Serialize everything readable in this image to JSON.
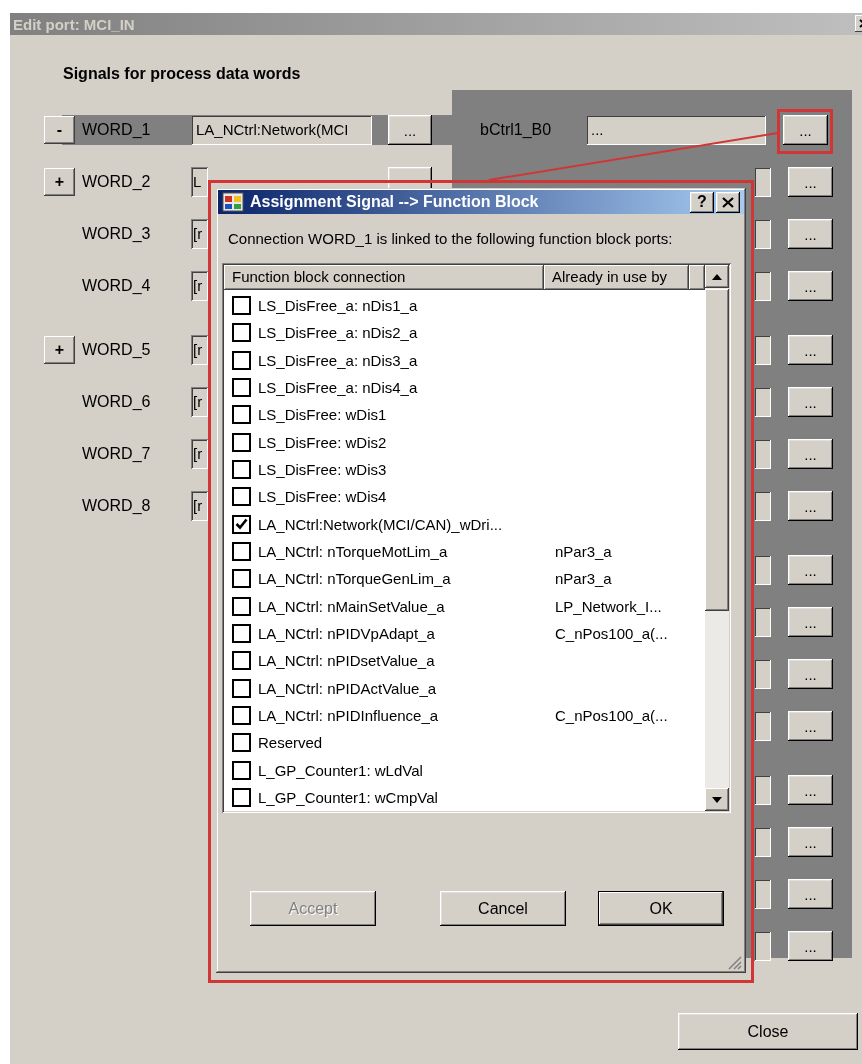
{
  "window": {
    "title": "Edit port: MCI_IN",
    "heading": "Signals for process data words",
    "close_button": "Close"
  },
  "words": [
    {
      "toggle": "-",
      "label": "WORD_1",
      "value": "LA_NCtrl:Network(MCI",
      "selected": true,
      "browse_button": true,
      "browse_label": "..."
    },
    {
      "toggle": "+",
      "label": "WORD_2",
      "value": "L",
      "selected": false,
      "browse_button": true
    },
    {
      "label": "WORD_3",
      "value": "[r",
      "selected": false,
      "browse_button": false
    },
    {
      "label": "WORD_4",
      "value": "[r",
      "selected": false,
      "browse_button": false
    },
    {
      "toggle": "+",
      "label": "WORD_5",
      "value": "[r",
      "selected": false,
      "browse_button": false
    },
    {
      "label": "WORD_6",
      "value": "[r",
      "selected": false,
      "browse_button": false
    },
    {
      "label": "WORD_7",
      "value": "[r",
      "selected": false,
      "browse_button": false
    },
    {
      "label": "WORD_8",
      "value": "[r",
      "selected": false,
      "browse_button": false
    }
  ],
  "bits": [
    {
      "label": "bCtrl1_B0",
      "value": "...",
      "button": "...",
      "highlighted": true
    },
    {
      "button": "...",
      "highlighted": false
    },
    {
      "button": "...",
      "highlighted": false
    },
    {
      "button": "...",
      "highlighted": false
    },
    {
      "button": "...",
      "highlighted": false
    },
    {
      "button": "...",
      "highlighted": false
    },
    {
      "button": "...",
      "highlighted": false
    },
    {
      "button": "...",
      "highlighted": false
    },
    {
      "button": "...",
      "highlighted": false
    },
    {
      "button": "...",
      "highlighted": false
    },
    {
      "button": "...",
      "highlighted": false
    },
    {
      "button": "...",
      "highlighted": false
    },
    {
      "button": "...",
      "highlighted": false
    },
    {
      "button": "...",
      "highlighted": false
    },
    {
      "button": "...",
      "highlighted": false
    },
    {
      "button": "...",
      "highlighted": false
    }
  ],
  "dialog": {
    "title": "Assignment Signal --> Function Block",
    "help_button": "?",
    "message": "Connection WORD_1 is linked to the following function block ports:",
    "columns": [
      "Function block connection",
      "Already in use by"
    ],
    "rows": [
      {
        "name": "LS_DisFree_a: nDis1_a",
        "checked": false
      },
      {
        "name": "LS_DisFree_a: nDis2_a",
        "checked": false
      },
      {
        "name": "LS_DisFree_a: nDis3_a",
        "checked": false
      },
      {
        "name": "LS_DisFree_a: nDis4_a",
        "checked": false
      },
      {
        "name": "LS_DisFree: wDis1",
        "checked": false
      },
      {
        "name": "LS_DisFree: wDis2",
        "checked": false
      },
      {
        "name": "LS_DisFree: wDis3",
        "checked": false
      },
      {
        "name": "LS_DisFree: wDis4",
        "checked": false
      },
      {
        "name": "LA_NCtrl:Network(MCI/CAN)_wDri...",
        "checked": true
      },
      {
        "name": "LA_NCtrl: nTorqueMotLim_a",
        "used_by": "nPar3_a",
        "checked": false
      },
      {
        "name": "LA_NCtrl: nTorqueGenLim_a",
        "used_by": "nPar3_a",
        "checked": false
      },
      {
        "name": "LA_NCtrl: nMainSetValue_a",
        "used_by": "LP_Network_I...",
        "checked": false
      },
      {
        "name": "LA_NCtrl: nPIDVpAdapt_a",
        "used_by": "C_nPos100_a(...",
        "checked": false
      },
      {
        "name": "LA_NCtrl: nPIDsetValue_a",
        "checked": false
      },
      {
        "name": "LA_NCtrl: nPIDActValue_a",
        "checked": false
      },
      {
        "name": "LA_NCtrl: nPIDInfluence_a",
        "used_by": "C_nPos100_a(...",
        "checked": false
      },
      {
        "name": "Reserved",
        "checked": false
      },
      {
        "name": "L_GP_Counter1: wLdVal",
        "checked": false
      },
      {
        "name": "L_GP_Counter1: wCmpVal",
        "checked": false
      }
    ],
    "buttons": [
      {
        "label": "Accept",
        "disabled": true,
        "default": false
      },
      {
        "label": "Cancel",
        "disabled": false,
        "default": false
      },
      {
        "label": "OK",
        "disabled": false,
        "default": true
      }
    ]
  }
}
